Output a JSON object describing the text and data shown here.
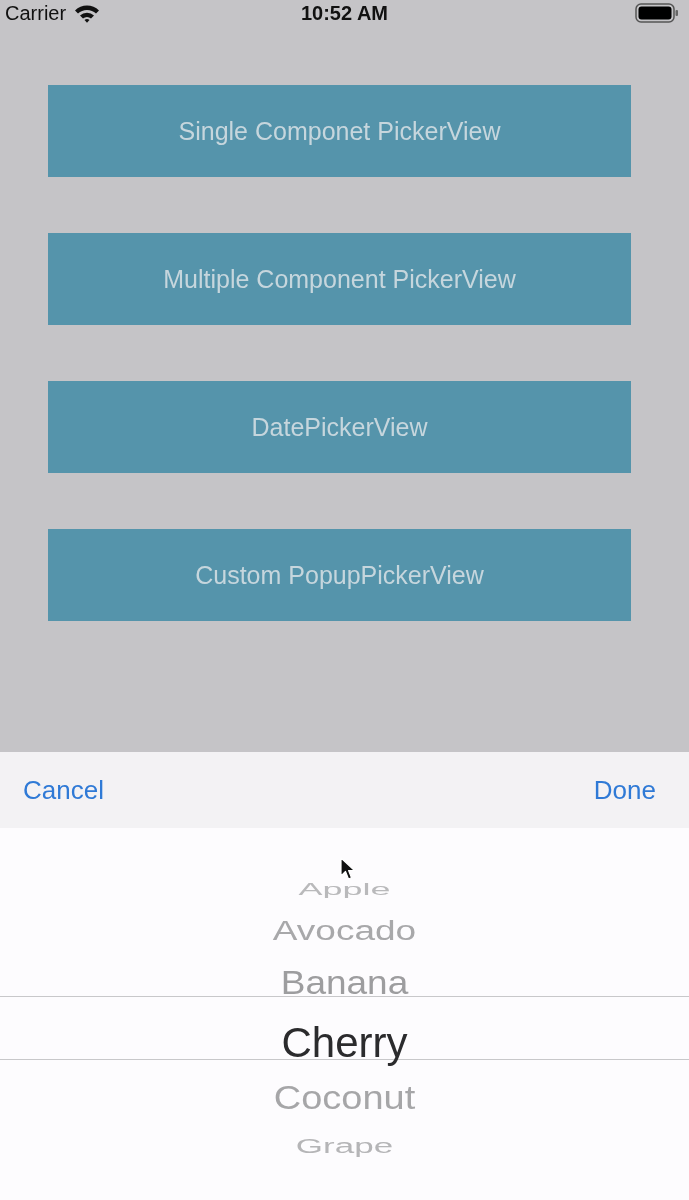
{
  "status_bar": {
    "carrier": "Carrier",
    "time": "10:52 AM"
  },
  "buttons": [
    {
      "label": "Single Componet PickerView"
    },
    {
      "label": "Multiple Component PickerView"
    },
    {
      "label": "DatePickerView"
    },
    {
      "label": "Custom PopupPickerView"
    }
  ],
  "toolbar": {
    "cancel": "Cancel",
    "done": "Done"
  },
  "picker": {
    "items": [
      {
        "label": "Apple",
        "selected": false
      },
      {
        "label": "Avocado",
        "selected": false
      },
      {
        "label": "Banana",
        "selected": false
      },
      {
        "label": "Cherry",
        "selected": true
      },
      {
        "label": "Coconut",
        "selected": false
      },
      {
        "label": "Grape",
        "selected": false
      }
    ]
  }
}
